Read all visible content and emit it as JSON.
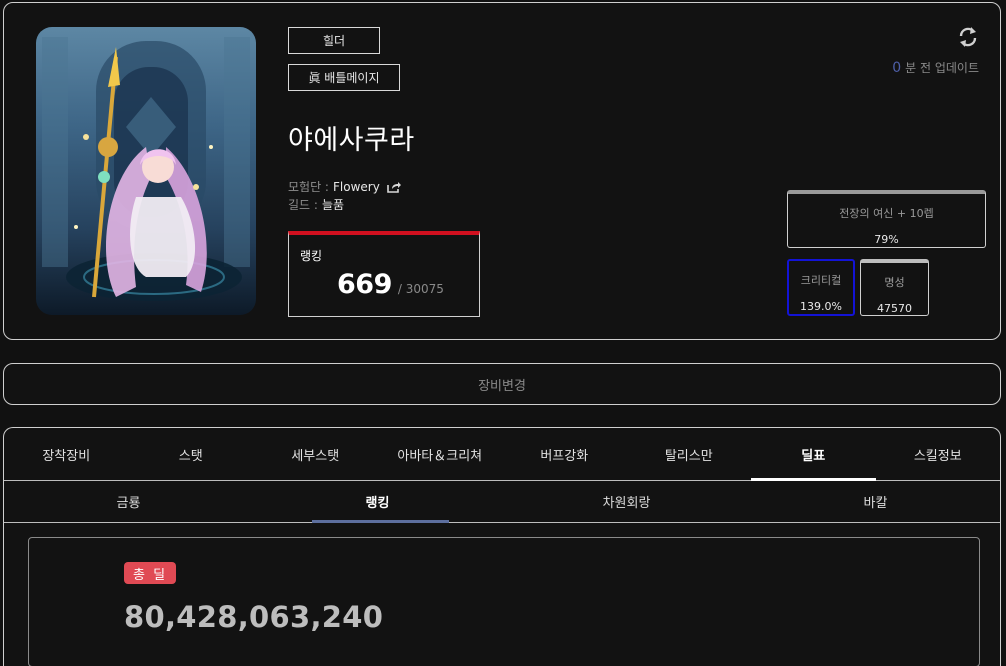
{
  "profile": {
    "class_tag": "힐더",
    "advance_tag": "眞 배틀메이지",
    "name": "야에사쿠라",
    "adventure_label": "모험단 :",
    "adventure_value": "Flowery",
    "guild_label": "길드 :",
    "guild_value": "늘품",
    "ranking": {
      "label": "랭킹",
      "value": "669",
      "total": "/ 30075"
    },
    "update": {
      "count": "0",
      "text": "분 전 업데이트"
    }
  },
  "stats": {
    "title": {
      "label": "전장의 여신 + 10렙",
      "value": "79%"
    },
    "critical": {
      "label": "크리티컬",
      "value": "139.0%"
    },
    "fame": {
      "label": "명성",
      "value": "47570"
    }
  },
  "equip_change_label": "장비변경",
  "main_tabs": [
    {
      "label": "장착장비"
    },
    {
      "label": "스탯"
    },
    {
      "label": "세부스탯"
    },
    {
      "label": "아바타＆크리쳐"
    },
    {
      "label": "버프강화"
    },
    {
      "label": "탈리스만"
    },
    {
      "label": "딜표"
    },
    {
      "label": "스킬정보"
    }
  ],
  "active_main_tab": "딜표",
  "sub_tabs": [
    {
      "label": "금룡"
    },
    {
      "label": "랭킹"
    },
    {
      "label": "차원회랑"
    },
    {
      "label": "바칼"
    }
  ],
  "active_sub_tab": "랭킹",
  "damage": {
    "badge": "총 딜",
    "value": "80,428,063,240"
  },
  "colors": {
    "rank_accent": "#d1101f",
    "crit_accent": "#1313d6",
    "badge_red": "#e04a54",
    "update_blue": "#4e5fa8",
    "sub_tab_underline": "#5d6f9e"
  }
}
